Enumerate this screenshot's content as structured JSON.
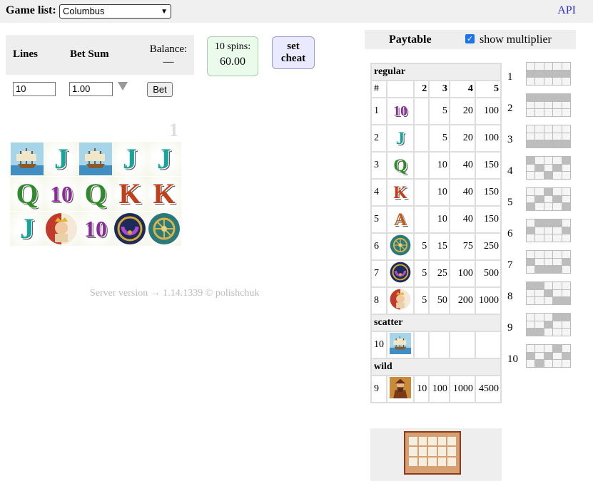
{
  "header": {
    "game_list_label": "Game list:",
    "selected_game": "Columbus",
    "api_link": "API"
  },
  "bet_panel": {
    "lines_label": "Lines",
    "bet_sum_label": "Bet Sum",
    "balance_label": "Balance:",
    "balance_value": "—",
    "lines_value": "10",
    "bet_value": "1.00",
    "bet_button": "Bet",
    "spins_label": "10 spins:",
    "spins_value": "60.00",
    "cheat_line1": "set",
    "cheat_line2": "cheat"
  },
  "reels": {
    "spin_number": "1",
    "symbols": [
      [
        "ship",
        "J",
        "ship",
        "J",
        "J"
      ],
      [
        "Q",
        "10",
        "Q",
        "K",
        "K"
      ],
      [
        "J",
        "queen",
        "10",
        "amulet",
        "astrolabe"
      ]
    ]
  },
  "footer": {
    "text": "Server version → 1.14.1339   ©   polishchuk"
  },
  "paytable": {
    "title": "Paytable",
    "show_multiplier_label": "show multiplier",
    "show_multiplier_checked": true,
    "section_regular": "regular",
    "columns": [
      "#",
      "",
      "2",
      "3",
      "4",
      "5"
    ],
    "regular": [
      {
        "id": "1",
        "icon": "10",
        "p2": "",
        "p3": "5",
        "p4": "20",
        "p5": "100"
      },
      {
        "id": "2",
        "icon": "J",
        "p2": "",
        "p3": "5",
        "p4": "20",
        "p5": "100"
      },
      {
        "id": "3",
        "icon": "Q",
        "p2": "",
        "p3": "10",
        "p4": "40",
        "p5": "150"
      },
      {
        "id": "4",
        "icon": "K",
        "p2": "",
        "p3": "10",
        "p4": "40",
        "p5": "150"
      },
      {
        "id": "5",
        "icon": "A",
        "p2": "",
        "p3": "10",
        "p4": "40",
        "p5": "150"
      },
      {
        "id": "6",
        "icon": "astrolabe",
        "p2": "5",
        "p3": "15",
        "p4": "75",
        "p5": "250"
      },
      {
        "id": "7",
        "icon": "amulet",
        "p2": "5",
        "p3": "25",
        "p4": "100",
        "p5": "500"
      },
      {
        "id": "8",
        "icon": "queen",
        "p2": "5",
        "p3": "50",
        "p4": "200",
        "p5": "1000"
      }
    ],
    "section_scatter": "scatter",
    "scatter": [
      {
        "id": "10",
        "icon": "ship",
        "p2": "",
        "p3": "",
        "p4": "",
        "p5": ""
      }
    ],
    "section_wild": "wild",
    "wild": [
      {
        "id": "9",
        "icon": "columbus",
        "p2": "10",
        "p3": "100",
        "p4": "1000",
        "p5": "4500"
      }
    ]
  },
  "paylines": [
    "1",
    "2",
    "3",
    "4",
    "5",
    "6",
    "7",
    "8",
    "9",
    "10"
  ],
  "colors": {
    "link": "#3333cc",
    "panel_bg": "#eeeeee",
    "spins_bg": "#ebfbeb",
    "cheat_bg": "#e9e9ff",
    "checkbox": "#1a73e8"
  }
}
